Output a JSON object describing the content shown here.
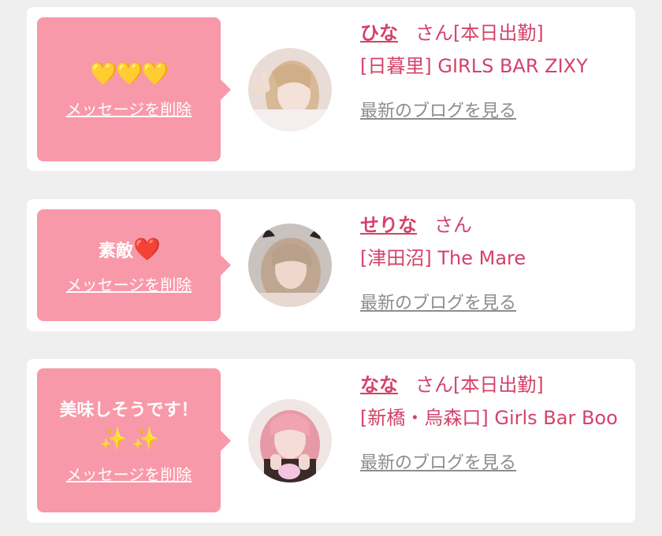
{
  "common": {
    "delete_label": "メッセージを削除",
    "honorific": "さん",
    "blog_label": "最新のブログを見る"
  },
  "cards": [
    {
      "message_text": "",
      "message_emoji": "💛💛💛",
      "name": "ひな",
      "status": "[本日出勤]",
      "shop": "[日暮里] GIRLS BAR ZIXY",
      "avatar_icon": "woman-peace-sign-avatar"
    },
    {
      "message_text": "素敵",
      "message_emoji": "❤️",
      "name": "せりな",
      "status": "",
      "shop": "[津田沼] The Mare",
      "avatar_icon": "woman-bunny-ears-avatar"
    },
    {
      "message_text": "美味しそうです！",
      "message_emoji": "✨ ✨",
      "name": "なな",
      "status": "[本日出勤]",
      "shop": "[新橋・烏森口] Girls Bar Boo",
      "avatar_icon": "woman-pink-hair-avatar"
    }
  ],
  "colors": {
    "accent": "#d4426a",
    "bubble": "#f899a9",
    "background": "#efefef"
  }
}
